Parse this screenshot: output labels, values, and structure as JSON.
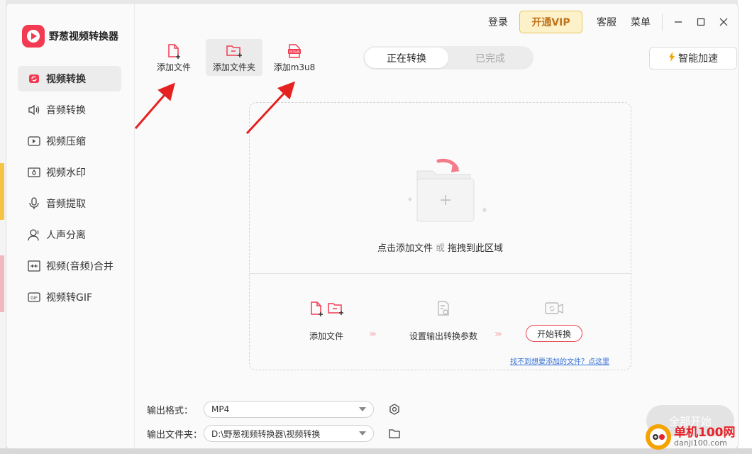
{
  "app": {
    "name": "野葱视频转换器"
  },
  "topbar": {
    "login": "登录",
    "vip": "开通VIP",
    "service": "客服",
    "menu": "菜单"
  },
  "sidebar": {
    "items": [
      {
        "label": "视频转换",
        "icon": "video-convert-icon",
        "active": true
      },
      {
        "label": "音频转换",
        "icon": "audio-speaker-icon"
      },
      {
        "label": "视频压缩",
        "icon": "video-compress-icon"
      },
      {
        "label": "视频水印",
        "icon": "video-watermark-icon"
      },
      {
        "label": "音频提取",
        "icon": "audio-extract-icon"
      },
      {
        "label": "人声分离",
        "icon": "voice-separate-icon"
      },
      {
        "label": "视频(音频)合并",
        "icon": "merge-icon"
      },
      {
        "label": "视频转GIF",
        "icon": "gif-icon"
      }
    ]
  },
  "toolbar": {
    "add_file": "添加文件",
    "add_folder": "添加文件夹",
    "add_m3u8": "添加m3u8"
  },
  "tabs": {
    "converting": "正在转换",
    "done": "已完成"
  },
  "speed": {
    "label": "智能加速"
  },
  "dropzone": {
    "hint_left": "点击添加文件",
    "hint_or": "或",
    "hint_right": "拖拽到此区域",
    "steps": [
      "添加文件",
      "设置输出转换参数"
    ],
    "start": "开始转换",
    "help": "找不到想要添加的文件？点这里"
  },
  "form": {
    "format_label": "输出格式：",
    "format_value": "MP4",
    "folder_label": "输出文件夹：",
    "folder_value": "D:\\野葱视频转换器\\视频转换"
  },
  "start_all": "全部开始",
  "watermark": {
    "main": "单机100网",
    "sub": "danji100.com"
  },
  "colors": {
    "accent": "#f23b52",
    "vip_bg": "#fdf1c9",
    "vip_text": "#c0741b",
    "link": "#3873d6"
  }
}
